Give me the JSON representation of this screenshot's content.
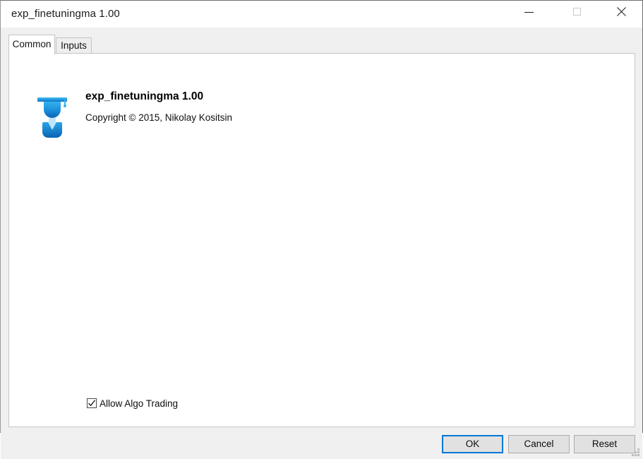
{
  "window": {
    "title": "exp_finetuningma 1.00",
    "controls": {
      "minimize": "minimize",
      "maximize": "maximize",
      "close": "close"
    }
  },
  "tabs": [
    {
      "label": "Common",
      "active": true
    },
    {
      "label": "Inputs",
      "active": false
    }
  ],
  "common_tab": {
    "app_name": "exp_finetuningma 1.00",
    "copyright": "Copyright © 2015, Nikolay Kositsin",
    "icon_name": "graduate-icon",
    "algo_trading": {
      "label": "Allow Algo Trading",
      "checked": true
    }
  },
  "footer": {
    "ok_label": "OK",
    "cancel_label": "Cancel",
    "reset_label": "Reset"
  },
  "colors": {
    "accent": "#0078d7",
    "icon_blue": "#0f7fd0",
    "icon_light_blue": "#31b6ef",
    "window_bg": "#f0f0f0",
    "panel_bg": "#ffffff",
    "border": "#c4c4c4"
  }
}
